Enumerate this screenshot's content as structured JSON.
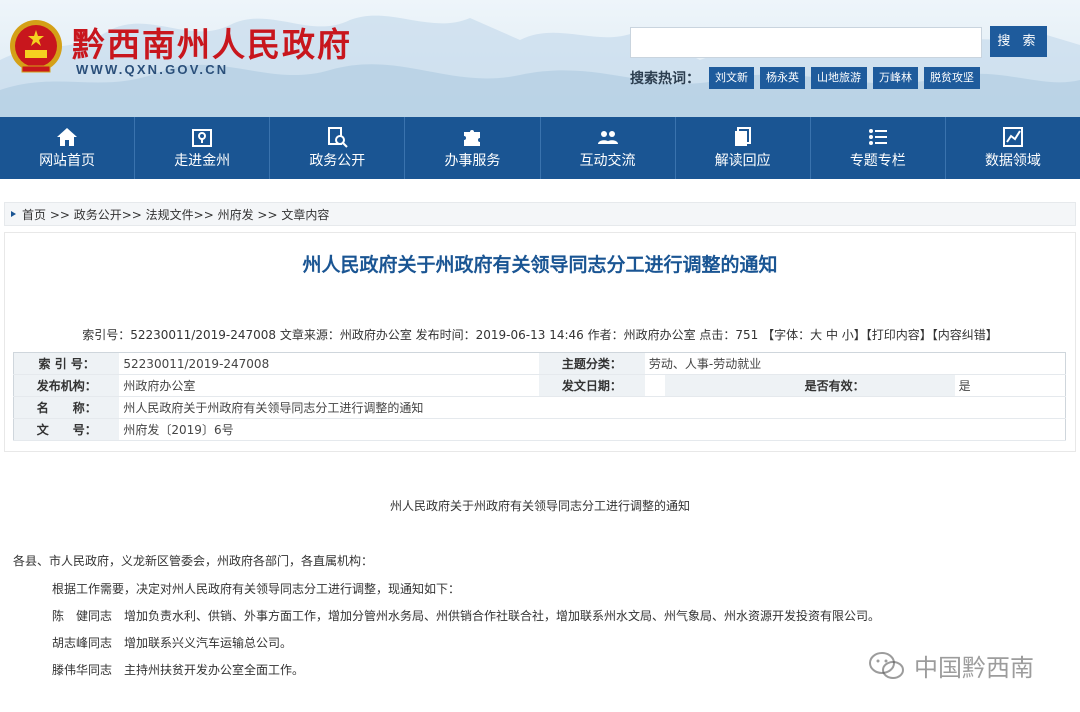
{
  "header": {
    "site_title": "黔西南州人民政府",
    "site_url": "WWW.QXN.GOV.CN",
    "search_button": "搜 索",
    "hot_label": "搜索热词：",
    "hot_tags": [
      "刘文新",
      "杨永英",
      "山地旅游",
      "万峰林",
      "脱贫攻坚"
    ]
  },
  "nav": [
    {
      "label": "网站首页",
      "icon": "home-icon"
    },
    {
      "label": "走进金州",
      "icon": "map-pin-icon"
    },
    {
      "label": "政务公开",
      "icon": "document-search-icon"
    },
    {
      "label": "办事服务",
      "icon": "puzzle-icon"
    },
    {
      "label": "互动交流",
      "icon": "people-icon"
    },
    {
      "label": "解读回应",
      "icon": "copy-icon"
    },
    {
      "label": "专题专栏",
      "icon": "list-icon"
    },
    {
      "label": "数据领域",
      "icon": "chart-icon"
    }
  ],
  "breadcrumb": "首页 >> 政务公开>> 法规文件>> 州府发 >> 文章内容",
  "article": {
    "title": "州人民政府关于州政府有关领导同志分工进行调整的通知",
    "meta": "索引号：52230011/2019-247008 文章来源：州政府办公室 发布时间：2019-06-13 14:46 作者：州政府办公室 点击：751 【字体：大 中 小】【打印内容】【内容纠错】"
  },
  "info": {
    "index_label": "索 引 号：",
    "index_value": "52230011/2019-247008",
    "topic_label": "主题分类：",
    "topic_value": "劳动、人事-劳动就业",
    "org_label": "发布机构：",
    "org_value": "州政府办公室",
    "date_label": "发文日期：",
    "date_value": "",
    "valid_label": "是否有效：",
    "valid_value": "是",
    "name_label": "名　　称：",
    "name_value": "州人民政府关于州政府有关领导同志分工进行调整的通知",
    "doc_label": "文　　号：",
    "doc_value": "州府发〔2019〕6号"
  },
  "body": {
    "title": "州人民政府关于州政府有关领导同志分工进行调整的通知",
    "salutation": "各县、市人民政府，义龙新区管委会，州政府各部门，各直属机构：",
    "p1": "根据工作需要，决定对州人民政府有关领导同志分工进行调整，现通知如下：",
    "p2": "陈　健同志　增加负责水利、供销、外事方面工作，增加分管州水务局、州供销合作社联合社，增加联系州水文局、州气象局、州水资源开发投资有限公司。",
    "p3": "胡志峰同志　增加联系兴义汽车运输总公司。",
    "p4": "滕伟华同志　主持州扶贫开发办公室全面工作。"
  },
  "watermark": "中国黔西南",
  "colors": {
    "brand_blue": "#1a5593",
    "title_red": "#c8161d"
  }
}
